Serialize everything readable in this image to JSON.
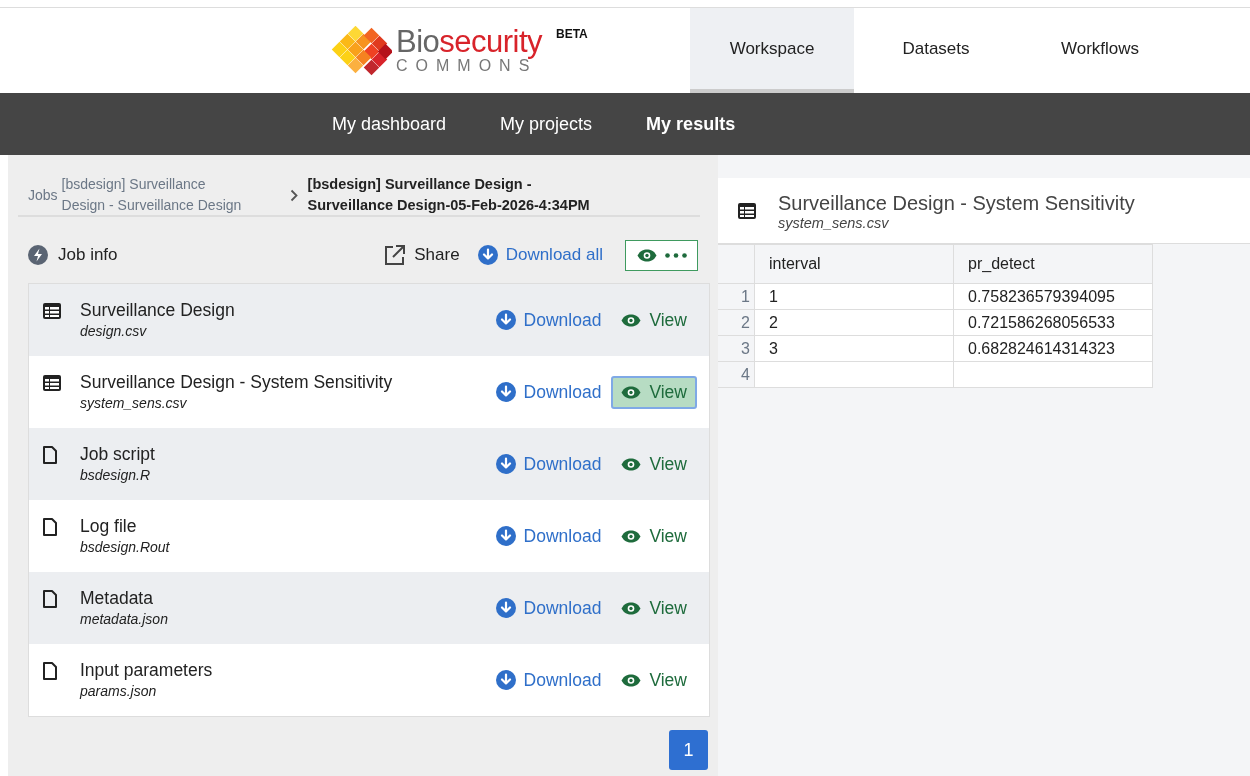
{
  "brand": {
    "name_start": "Bio",
    "name_end": "security",
    "subtitle": "COMMONS",
    "badge": "BETA"
  },
  "tabs": [
    {
      "label": "Workspace",
      "selected": true
    },
    {
      "label": "Datasets",
      "selected": false
    },
    {
      "label": "Workflows",
      "selected": false
    }
  ],
  "subnav": [
    {
      "label": "My dashboard",
      "selected": false
    },
    {
      "label": "My projects",
      "selected": false
    },
    {
      "label": "My results",
      "selected": true
    }
  ],
  "breadcrumb": {
    "root": "Jobs",
    "parent": "[bsdesign] Surveillance Design - Surveillance Design",
    "current": "[bsdesign] Surveillance Design - Surveillance Design-05-Feb-2026-4:34PM"
  },
  "toolbar": {
    "job_info": "Job info",
    "share": "Share",
    "download_all": "Download all"
  },
  "files": [
    {
      "kind": "table",
      "title": "Surveillance Design",
      "filename": "design.csv",
      "download": "Download",
      "view": "View",
      "selected": false
    },
    {
      "kind": "table",
      "title": "Surveillance Design - System Sensitivity",
      "filename": "system_sens.csv",
      "download": "Download",
      "view": "View",
      "selected": true
    },
    {
      "kind": "file",
      "title": "Job script",
      "filename": "bsdesign.R",
      "download": "Download",
      "view": "View",
      "selected": false
    },
    {
      "kind": "file",
      "title": "Log file",
      "filename": "bsdesign.Rout",
      "download": "Download",
      "view": "View",
      "selected": false
    },
    {
      "kind": "file",
      "title": "Metadata",
      "filename": "metadata.json",
      "download": "Download",
      "view": "View",
      "selected": false
    },
    {
      "kind": "file",
      "title": "Input parameters",
      "filename": "params.json",
      "download": "Download",
      "view": "View",
      "selected": false
    }
  ],
  "pagination": [
    {
      "label": "1",
      "selected": true
    }
  ],
  "preview": {
    "title": "Surveillance Design - System Sensitivity",
    "filename": "system_sens.csv",
    "table": {
      "columns": [
        "interval",
        "pr_detect"
      ],
      "rows": [
        {
          "number": "1",
          "cells": [
            "1",
            "0.758236579394095"
          ]
        },
        {
          "number": "2",
          "cells": [
            "2",
            "0.721586268056533"
          ]
        },
        {
          "number": "3",
          "cells": [
            "3",
            "0.682824614314323"
          ]
        },
        {
          "number": "4",
          "cells": []
        }
      ]
    }
  }
}
